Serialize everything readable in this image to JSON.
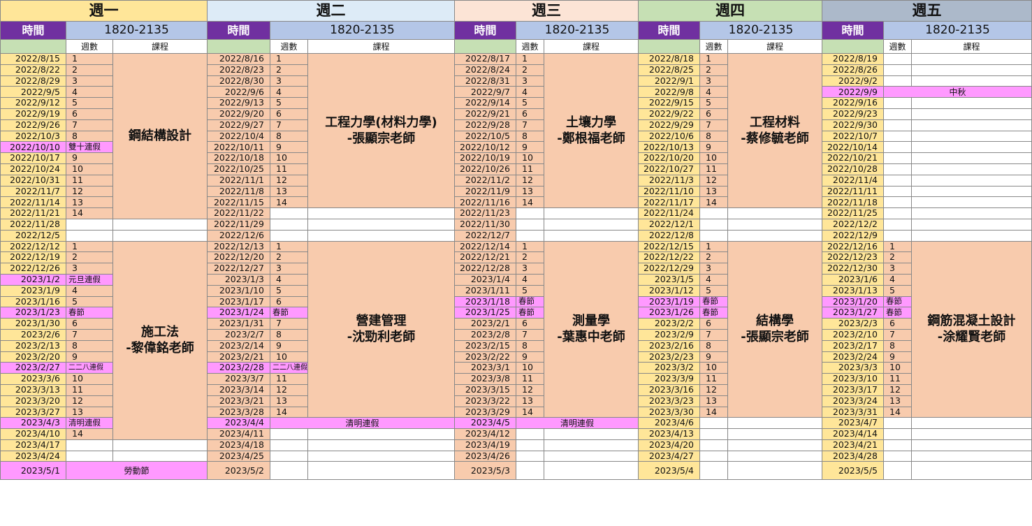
{
  "time_label": "時間",
  "time_value": "1820-2135",
  "week_col_label": "週數",
  "course_col_label": "課程",
  "days": [
    {
      "name": "週一",
      "header_color": "#ffe699",
      "date_color": "ylw",
      "dates": [
        "2022/8/15",
        "2022/8/22",
        "2022/8/29",
        "2022/9/5",
        "2022/9/12",
        "2022/9/19",
        "2022/9/26",
        "2022/10/3",
        "2022/10/10",
        "2022/10/17",
        "2022/10/24",
        "2022/10/31",
        "2022/11/7",
        "2022/11/14",
        "2022/11/21",
        "2022/11/28",
        "2022/12/5",
        "2022/12/12",
        "2022/12/19",
        "2022/12/26",
        "2023/1/2",
        "2023/1/9",
        "2023/1/16",
        "2023/1/23",
        "2023/1/30",
        "2023/2/6",
        "2023/2/13",
        "2023/2/20",
        "2023/2/27",
        "2023/3/6",
        "2023/3/13",
        "2023/3/20",
        "2023/3/27",
        "2023/4/3",
        "2023/4/10",
        "2023/4/17",
        "2023/4/24",
        "2023/5/1"
      ],
      "weeks": [
        "1",
        "2",
        "3",
        "4",
        "5",
        "6",
        "7",
        "8",
        "雙十連假",
        "9",
        "10",
        "11",
        "12",
        "13",
        "14",
        "",
        "",
        "1",
        "2",
        "3",
        "元旦連假",
        "4",
        "5",
        "春節",
        "6",
        "7",
        "8",
        "9",
        "二二八連假",
        "10",
        "11",
        "12",
        "13",
        "清明連假",
        "14",
        "",
        "",
        ""
      ],
      "holiday_rows": [
        8,
        20,
        23,
        28,
        33
      ],
      "courses": [
        {
          "start": 0,
          "span": 15,
          "lines": [
            "鋼結構設計"
          ]
        },
        {
          "start": 17,
          "span": 18,
          "lines": [
            "施工法",
            "-黎偉銘老師"
          ]
        }
      ],
      "full_row_holidays": [
        {
          "row": 37,
          "label": "勞動節"
        }
      ]
    },
    {
      "name": "週二",
      "header_color": "#ddebf7",
      "date_color": "pch",
      "dates": [
        "2022/8/16",
        "2022/8/23",
        "2022/8/30",
        "2022/9/6",
        "2022/9/13",
        "2022/9/20",
        "2022/9/27",
        "2022/10/4",
        "2022/10/11",
        "2022/10/18",
        "2022/10/25",
        "2022/11/1",
        "2022/11/8",
        "2022/11/15",
        "2022/11/22",
        "2022/11/29",
        "2022/12/6",
        "2022/12/13",
        "2022/12/20",
        "2022/12/27",
        "2023/1/3",
        "2023/1/10",
        "2023/1/17",
        "2023/1/24",
        "2023/1/31",
        "2023/2/7",
        "2023/2/14",
        "2023/2/21",
        "2023/2/28",
        "2023/3/7",
        "2023/3/14",
        "2023/3/21",
        "2023/3/28",
        "2023/4/4",
        "2023/4/11",
        "2023/4/18",
        "2023/4/25",
        "2023/5/2"
      ],
      "weeks": [
        "1",
        "2",
        "3",
        "4",
        "5",
        "6",
        "7",
        "8",
        "9",
        "10",
        "11",
        "12",
        "13",
        "14",
        "",
        "",
        "",
        "1",
        "2",
        "3",
        "4",
        "5",
        "6",
        "春節",
        "7",
        "8",
        "9",
        "10",
        "二二八連假",
        "11",
        "12",
        "13",
        "14",
        "",
        "",
        "",
        "",
        ""
      ],
      "holiday_rows": [
        23,
        28
      ],
      "courses": [
        {
          "start": 0,
          "span": 14,
          "lines": [
            "工程力學(材料力學)",
            "-張顯宗老師"
          ]
        },
        {
          "start": 17,
          "span": 16,
          "lines": [
            "營建管理",
            "-沈勁利老師"
          ]
        }
      ],
      "full_row_holidays": [
        {
          "row": 33,
          "label": "清明連假"
        }
      ]
    },
    {
      "name": "週三",
      "header_color": "#fce4d6",
      "date_color": "pch",
      "dates": [
        "2022/8/17",
        "2022/8/24",
        "2022/8/31",
        "2022/9/7",
        "2022/9/14",
        "2022/9/21",
        "2022/9/28",
        "2022/10/5",
        "2022/10/12",
        "2022/10/19",
        "2022/10/26",
        "2022/11/2",
        "2022/11/9",
        "2022/11/16",
        "2022/11/23",
        "2022/11/30",
        "2022/12/7",
        "2022/12/14",
        "2022/12/21",
        "2022/12/28",
        "2023/1/4",
        "2023/1/11",
        "2023/1/18",
        "2023/1/25",
        "2023/2/1",
        "2023/2/8",
        "2023/2/15",
        "2023/2/22",
        "2023/3/1",
        "2023/3/8",
        "2023/3/15",
        "2023/3/22",
        "2023/3/29",
        "2023/4/5",
        "2023/4/12",
        "2023/4/19",
        "2023/4/26",
        "2023/5/3"
      ],
      "weeks": [
        "1",
        "2",
        "3",
        "4",
        "5",
        "6",
        "7",
        "8",
        "9",
        "10",
        "11",
        "12",
        "13",
        "14",
        "",
        "",
        "",
        "1",
        "2",
        "3",
        "4",
        "5",
        "春節",
        "春節",
        "6",
        "7",
        "8",
        "9",
        "10",
        "11",
        "12",
        "13",
        "14",
        "",
        "",
        "",
        "",
        ""
      ],
      "holiday_rows": [
        22,
        23
      ],
      "courses": [
        {
          "start": 0,
          "span": 14,
          "lines": [
            "土壤力學",
            "-鄭根福老師"
          ]
        },
        {
          "start": 17,
          "span": 16,
          "lines": [
            "測量學",
            "-葉惠中老師"
          ]
        }
      ],
      "full_row_holidays": [
        {
          "row": 33,
          "label": "清明連假"
        }
      ]
    },
    {
      "name": "週四",
      "header_color": "#c6e0b4",
      "date_color": "ylw",
      "dates": [
        "2022/8/18",
        "2022/8/25",
        "2022/9/1",
        "2022/9/8",
        "2022/9/15",
        "2022/9/22",
        "2022/9/29",
        "2022/10/6",
        "2022/10/13",
        "2022/10/20",
        "2022/10/27",
        "2022/11/3",
        "2022/11/10",
        "2022/11/17",
        "2022/11/24",
        "2022/12/1",
        "2022/12/8",
        "2022/12/15",
        "2022/12/22",
        "2022/12/29",
        "2023/1/5",
        "2023/1/12",
        "2023/1/19",
        "2023/1/26",
        "2023/2/2",
        "2023/2/9",
        "2023/2/16",
        "2023/2/23",
        "2023/3/2",
        "2023/3/9",
        "2023/3/16",
        "2023/3/23",
        "2023/3/30",
        "2023/4/6",
        "2023/4/13",
        "2023/4/20",
        "2023/4/27",
        "2023/5/4"
      ],
      "weeks": [
        "1",
        "2",
        "3",
        "4",
        "5",
        "6",
        "7",
        "8",
        "9",
        "10",
        "11",
        "12",
        "13",
        "14",
        "",
        "",
        "",
        "1",
        "2",
        "3",
        "4",
        "5",
        "春節",
        "春節",
        "6",
        "7",
        "8",
        "9",
        "10",
        "11",
        "12",
        "13",
        "14",
        "",
        "",
        "",
        "",
        ""
      ],
      "holiday_rows": [
        22,
        23
      ],
      "courses": [
        {
          "start": 0,
          "span": 14,
          "lines": [
            "工程材料",
            "-蔡修毓老師"
          ]
        },
        {
          "start": 17,
          "span": 16,
          "lines": [
            "結構學",
            "-張顯宗老師"
          ]
        }
      ],
      "full_row_holidays": []
    },
    {
      "name": "週五",
      "header_color": "#acb9ca",
      "date_color": "ylw",
      "dates": [
        "2022/8/19",
        "2022/8/26",
        "2022/9/2",
        "2022/9/9",
        "2022/9/16",
        "2022/9/23",
        "2022/9/30",
        "2022/10/7",
        "2022/10/14",
        "2022/10/21",
        "2022/10/28",
        "2022/11/4",
        "2022/11/11",
        "2022/11/18",
        "2022/11/25",
        "2022/12/2",
        "2022/12/9",
        "2022/12/16",
        "2022/12/23",
        "2022/12/30",
        "2023/1/6",
        "2023/1/13",
        "2023/1/20",
        "2023/1/27",
        "2023/2/3",
        "2023/2/10",
        "2023/2/17",
        "2023/2/24",
        "2023/3/3",
        "2023/3/10",
        "2023/3/17",
        "2023/3/24",
        "2023/3/31",
        "2023/4/7",
        "2023/4/14",
        "2023/4/21",
        "2023/4/28",
        "2023/5/5"
      ],
      "weeks": [
        "",
        "",
        "",
        "",
        "",
        "",
        "",
        "",
        "",
        "",
        "",
        "",
        "",
        "",
        "",
        "",
        "",
        "1",
        "2",
        "3",
        "4",
        "5",
        "春節",
        "春節",
        "6",
        "7",
        "8",
        "9",
        "10",
        "11",
        "12",
        "13",
        "14",
        "",
        "",
        "",
        "",
        ""
      ],
      "holiday_rows": [
        22,
        23
      ],
      "courses": [
        {
          "start": 17,
          "span": 16,
          "lines": [
            "鋼筋混凝土設計",
            "-涂耀賢老師"
          ]
        }
      ],
      "full_row_holidays": [
        {
          "row": 3,
          "label": "中秋"
        }
      ]
    }
  ]
}
